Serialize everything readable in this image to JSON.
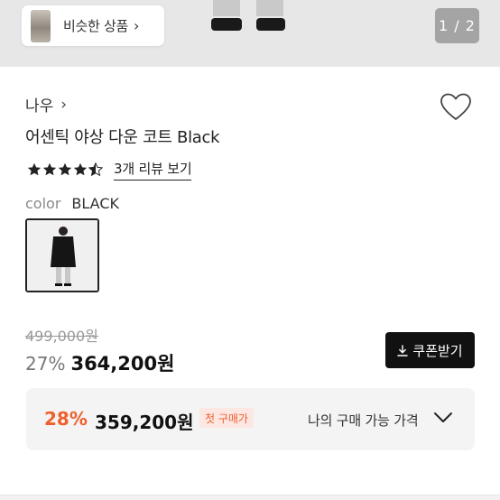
{
  "hero": {
    "similar_label": "비슷한 상품",
    "similar_chevron": "›",
    "page_indicator": "1 / 2"
  },
  "product": {
    "brand": "나우",
    "brand_chevron": "›",
    "title": "어센틱 야상 다운 코트 Black",
    "rating": 4.5,
    "review_link": "3개 리뷰 보기",
    "color_label": "color",
    "color_value": "BLACK"
  },
  "pricing": {
    "original_price": "499,000원",
    "discount_rate": "27%",
    "sale_price": "364,200원",
    "coupon_button": "쿠폰받기"
  },
  "best_price": {
    "discount_rate": "28%",
    "price": "359,200원",
    "badge": "첫 구매가",
    "label": "나의 구매 가능 가격"
  },
  "icons": {
    "wishlist": "heart-icon",
    "download": "download-icon",
    "expand": "chevron-down-icon",
    "star": "star-icon"
  },
  "colors": {
    "accent": "#ef5f2d",
    "primary_button": "#111111"
  }
}
